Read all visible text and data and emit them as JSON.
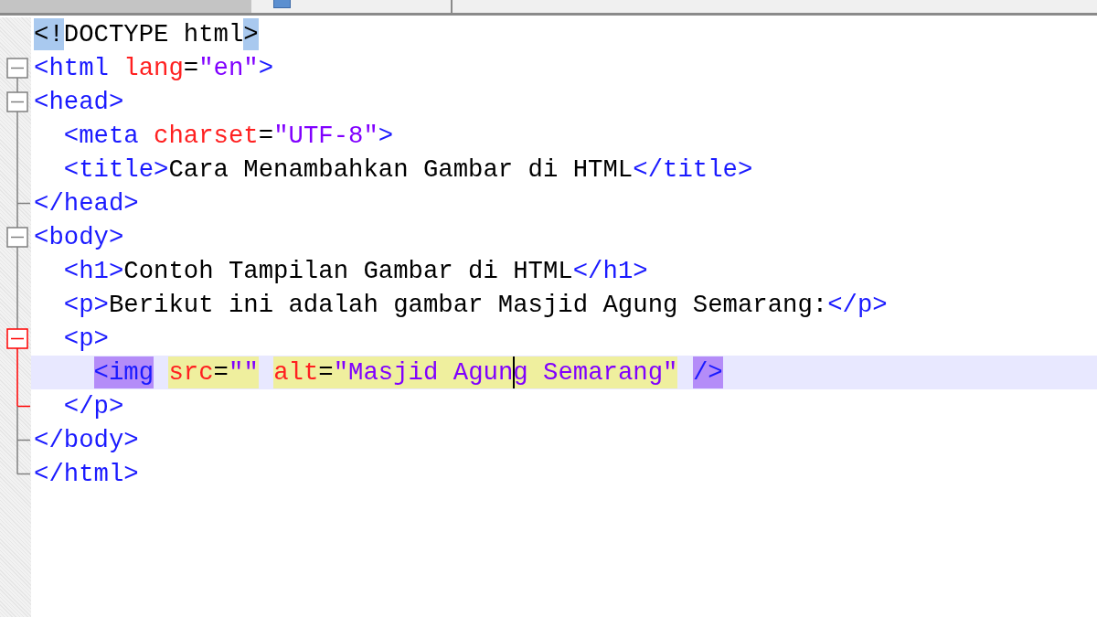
{
  "editor": {
    "lines": [
      {
        "fold": {
          "kind": "none"
        },
        "current": false,
        "tokens": [
          {
            "text": "<!",
            "kind": "brace-match"
          },
          {
            "text": "DOCTYPE html",
            "kind": "text"
          },
          {
            "text": ">",
            "kind": "brace-match"
          }
        ]
      },
      {
        "fold": {
          "kind": "first",
          "active": false
        },
        "current": false,
        "tokens": [
          {
            "text": "<html",
            "kind": "tag"
          },
          {
            "text": " lang",
            "kind": "attr"
          },
          {
            "text": "=",
            "kind": "text"
          },
          {
            "text": "\"en\"",
            "kind": "value"
          },
          {
            "text": ">",
            "kind": "tag"
          }
        ]
      },
      {
        "fold": {
          "kind": "box",
          "active": false
        },
        "current": false,
        "tokens": [
          {
            "text": "<head>",
            "kind": "tag"
          }
        ]
      },
      {
        "fold": {
          "kind": "line",
          "active": false
        },
        "current": false,
        "tokens": [
          {
            "text": "  <meta",
            "kind": "tag"
          },
          {
            "text": " charset",
            "kind": "attr"
          },
          {
            "text": "=",
            "kind": "text"
          },
          {
            "text": "\"UTF-8\"",
            "kind": "value"
          },
          {
            "text": ">",
            "kind": "tag"
          }
        ]
      },
      {
        "fold": {
          "kind": "line",
          "active": false
        },
        "current": false,
        "tokens": [
          {
            "text": "  <title>",
            "kind": "tag"
          },
          {
            "text": "Cara Menambahkan Gambar di HTML",
            "kind": "text"
          },
          {
            "text": "</title>",
            "kind": "tag"
          }
        ]
      },
      {
        "fold": {
          "kind": "end",
          "active": false
        },
        "current": false,
        "tokens": [
          {
            "text": "</head>",
            "kind": "tag"
          }
        ]
      },
      {
        "fold": {
          "kind": "box",
          "active": false
        },
        "current": false,
        "tokens": [
          {
            "text": "<body>",
            "kind": "tag"
          }
        ]
      },
      {
        "fold": {
          "kind": "line",
          "active": false
        },
        "current": false,
        "tokens": [
          {
            "text": "  <h1>",
            "kind": "tag"
          },
          {
            "text": "Contoh Tampilan Gambar di HTML",
            "kind": "text"
          },
          {
            "text": "</h1>",
            "kind": "tag"
          }
        ]
      },
      {
        "fold": {
          "kind": "line",
          "active": false
        },
        "current": false,
        "tokens": [
          {
            "text": "  <p>",
            "kind": "tag"
          },
          {
            "text": "Berikut ini adalah gambar Masjid Agung Semarang:",
            "kind": "text"
          },
          {
            "text": "</p>",
            "kind": "tag"
          }
        ]
      },
      {
        "fold": {
          "kind": "box",
          "active": true
        },
        "current": false,
        "tokens": [
          {
            "text": "  <p>",
            "kind": "tag"
          }
        ]
      },
      {
        "fold": {
          "kind": "line",
          "active": true
        },
        "current": true,
        "tokens": [
          {
            "text": "    <img",
            "kind": "tag-match"
          },
          {
            "text": " src",
            "kind": "attr-mark"
          },
          {
            "text": "=",
            "kind": "text-mark"
          },
          {
            "text": "\"\"",
            "kind": "value-mark"
          },
          {
            "text": " alt",
            "kind": "attr-mark"
          },
          {
            "text": "=",
            "kind": "text-mark"
          },
          {
            "text": "\"Masjid Agun",
            "kind": "value-mark"
          },
          {
            "text": "g Semarang\"",
            "kind": "value-mark-caret"
          },
          {
            "text": " />",
            "kind": "tag-match"
          }
        ]
      },
      {
        "fold": {
          "kind": "end",
          "active": true
        },
        "current": false,
        "tokens": [
          {
            "text": "  </p>",
            "kind": "tag"
          }
        ]
      },
      {
        "fold": {
          "kind": "end",
          "active": false
        },
        "current": false,
        "tokens": [
          {
            "text": "</body>",
            "kind": "tag"
          }
        ]
      },
      {
        "fold": {
          "kind": "last",
          "active": false
        },
        "current": false,
        "tokens": [
          {
            "text": "</html>",
            "kind": "tag"
          }
        ]
      }
    ]
  }
}
